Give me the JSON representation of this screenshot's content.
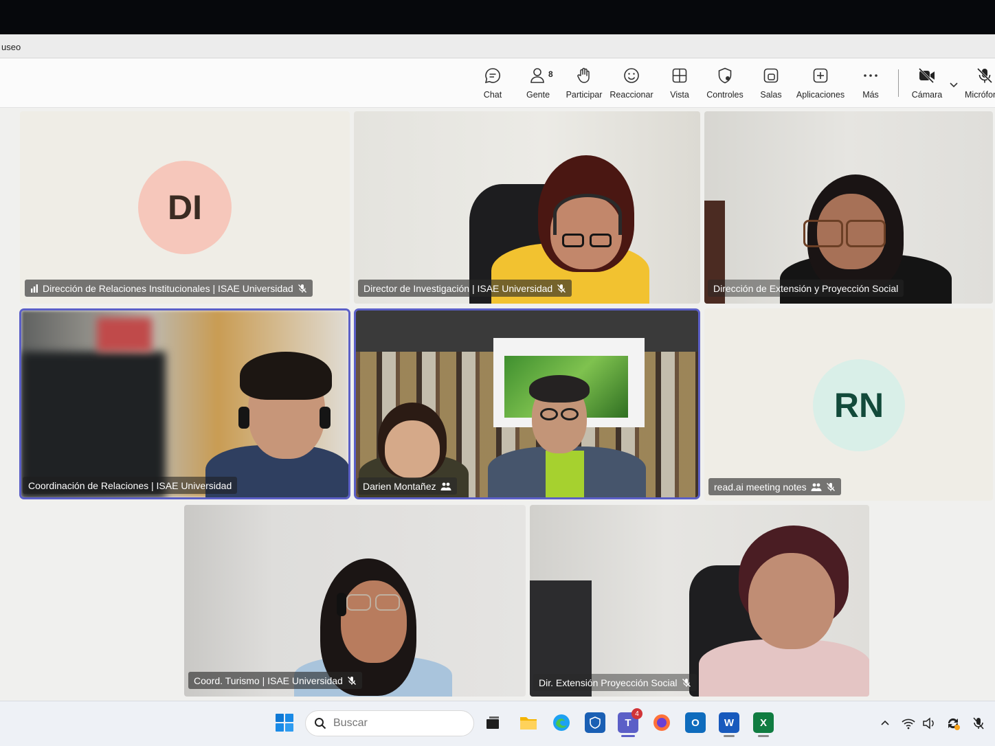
{
  "window": {
    "title": "useo"
  },
  "toolbar": {
    "chat": "Chat",
    "people": "Gente",
    "people_count": "8",
    "raise": "Participar",
    "react": "Reaccionar",
    "view": "Vista",
    "controls": "Controles",
    "rooms": "Salas",
    "apps": "Aplicaciones",
    "more": "Más",
    "camera": "Cámara",
    "mic": "Micrófono"
  },
  "participants": [
    {
      "name": "Dirección de Relaciones Institucionales | ISAE Universidad",
      "initials": "DI",
      "avatar_color": "#f6c7bb",
      "muted": true
    },
    {
      "name": "Director de Investigación | ISAE Universidad",
      "muted": true
    },
    {
      "name": "Dirección de Extensión y Proyección Social",
      "muted": false
    },
    {
      "name": "Coordinación de Relaciones | ISAE Universidad",
      "muted": false
    },
    {
      "name": "Darien Montañez",
      "muted": false
    },
    {
      "name": "read.ai meeting notes",
      "initials": "RN",
      "avatar_color": "#d9efe8",
      "muted": true
    },
    {
      "name": "Coord. Turismo | ISAE Universidad",
      "muted": true
    },
    {
      "name": "Dir. Extensión Proyección Social",
      "muted": true
    }
  ],
  "taskbar": {
    "search_placeholder": "Buscar",
    "teams_badge": "4"
  },
  "colors": {
    "accent": "#5b5fc7",
    "taskbar": "#eef1f6"
  }
}
